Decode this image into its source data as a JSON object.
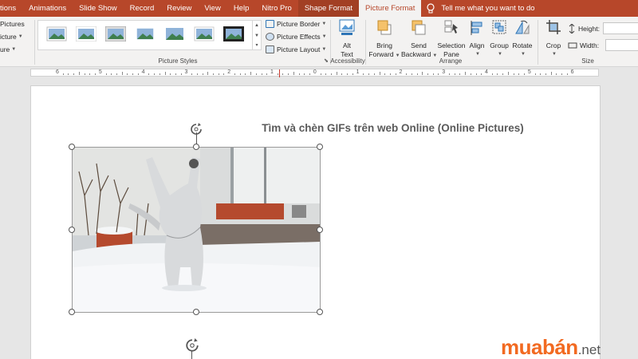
{
  "tabs": [
    {
      "label": "tions",
      "style": "first"
    },
    {
      "label": "Animations",
      "style": ""
    },
    {
      "label": "Slide Show",
      "style": ""
    },
    {
      "label": "Record",
      "style": ""
    },
    {
      "label": "Review",
      "style": ""
    },
    {
      "label": "View",
      "style": ""
    },
    {
      "label": "Help",
      "style": ""
    },
    {
      "label": "Nitro Pro",
      "style": ""
    },
    {
      "label": "Shape Format",
      "style": "contextual"
    },
    {
      "label": "Picture Format",
      "style": "active"
    }
  ],
  "tell_me": "Tell me what you want to do",
  "ribbon": {
    "left_items": [
      "Pictures",
      "icture",
      "ure"
    ],
    "picture_styles": {
      "label": "Picture Styles",
      "border": "Picture Border",
      "effects": "Picture Effects",
      "layout": "Picture Layout",
      "thumb_count": 7
    },
    "accessibility": {
      "label": "Accessibility",
      "alt_text_1": "Alt",
      "alt_text_2": "Text"
    },
    "arrange": {
      "label": "Arrange",
      "bring_forward_1": "Bring",
      "bring_forward_2": "Forward",
      "send_backward_1": "Send",
      "send_backward_2": "Backward",
      "selection_pane_1": "Selection",
      "selection_pane_2": "Pane",
      "align": "Align",
      "group": "Group",
      "rotate": "Rotate"
    },
    "size": {
      "label": "Size",
      "crop": "Crop",
      "height": "Height:",
      "width": "Width:"
    }
  },
  "ruler_numbers": [
    "6",
    "5",
    "4",
    "3",
    "2",
    "1",
    "0",
    "1",
    "2",
    "3",
    "4",
    "5",
    "6"
  ],
  "slide": {
    "title": "Tìm và chèn GIFs trên web Online (Online Pictures)"
  },
  "watermark": {
    "brand": "muabán",
    "suffix": ".net"
  },
  "colors": {
    "accent": "#b7472a",
    "watermark": "#f26a21"
  }
}
